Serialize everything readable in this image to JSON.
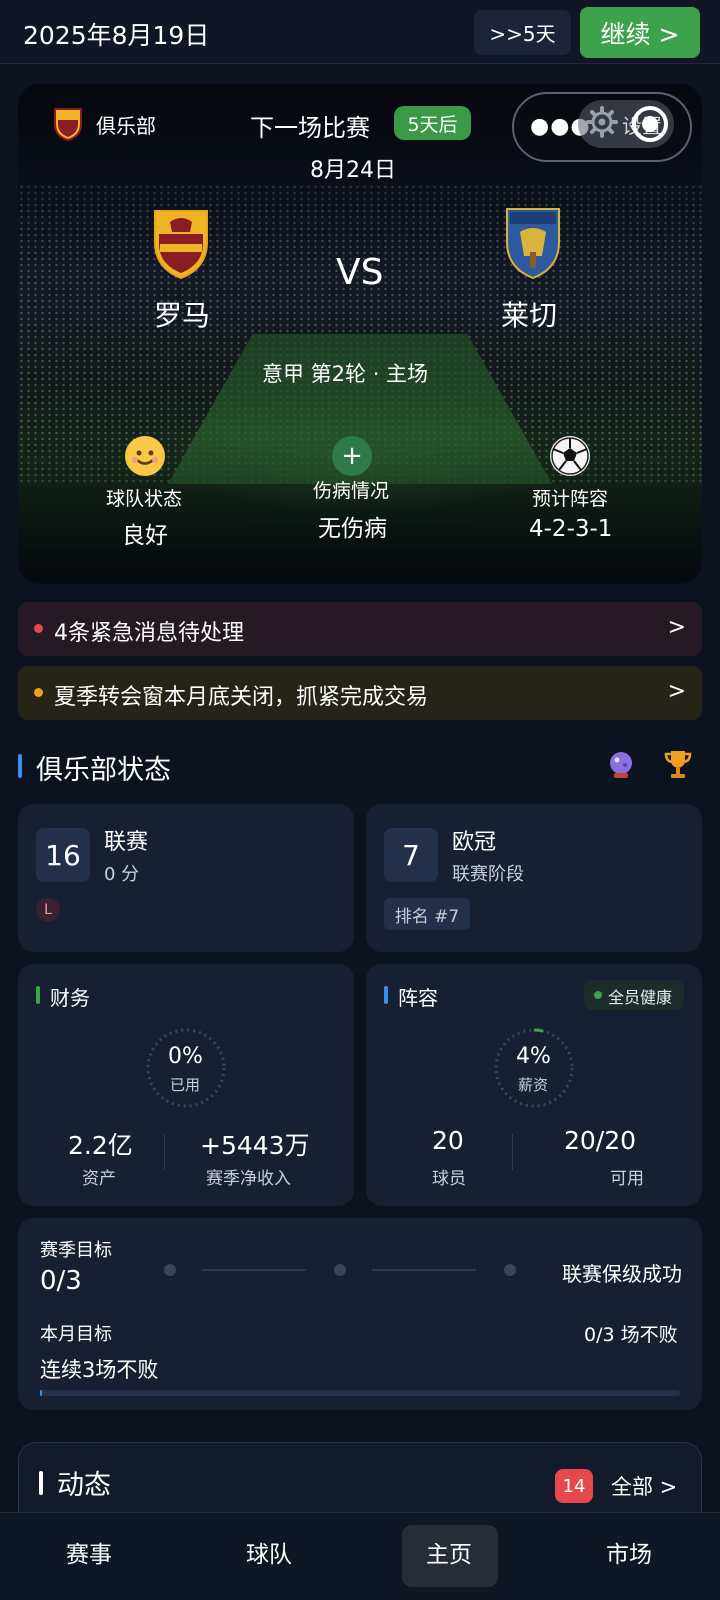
{
  "topbar": {
    "date": "2025年8月19日",
    "skip_label": ">>5天",
    "continue_label": "继续 >"
  },
  "match": {
    "club_label": "俱乐部",
    "next_label": "下一场比赛",
    "days_badge": "5天后",
    "date": "8月24日",
    "settings_label": "设置",
    "home_team": "罗马",
    "away_team": "莱切",
    "vs": "VS",
    "competition": "意甲 第2轮  ·  主场",
    "stats": [
      {
        "label": "球队状态",
        "value": "良好",
        "icon": "smiling-face-icon"
      },
      {
        "label": "伤病情况",
        "value": "无伤病",
        "icon": "medical-cross-icon"
      },
      {
        "label": "预计阵容",
        "value": "4-2-3-1",
        "icon": "soccer-ball-icon"
      }
    ]
  },
  "alerts": [
    {
      "text": "4条紧急消息待处理",
      "arrow": ">",
      "color": "#e5484d"
    },
    {
      "text": "夏季转会窗本月底关闭，抓紧完成交易",
      "arrow": ">",
      "color": "#f0a020"
    }
  ],
  "club_status": {
    "title": "俱乐部状态",
    "league": {
      "rank": "16",
      "name": "联赛",
      "points": "0 分",
      "form": "L"
    },
    "ucl": {
      "rank": "7",
      "name": "欧冠",
      "stage": "联赛阶段",
      "position": "排名 #7"
    },
    "finance": {
      "title": "财务",
      "ring_value": "0%",
      "ring_label": "已用",
      "ring_fraction": 0,
      "assets_value": "2.2亿",
      "assets_label": "资产",
      "income_value": "+5443万",
      "income_label": "赛季净收入"
    },
    "squad": {
      "title": "阵容",
      "badge": "全员健康",
      "ring_value": "4%",
      "ring_label": "薪资",
      "ring_fraction": 0.04,
      "players_value": "20",
      "players_label": "球员",
      "available_value": "20/20",
      "available_label": "可用"
    }
  },
  "goals": {
    "season_label": "赛季目标",
    "season_progress": "0/3",
    "season_goal": "联赛保级成功",
    "month_label": "本月目标",
    "month_goal": "连续3场不败",
    "month_progress": "0/3 场不败",
    "month_fraction": 0
  },
  "feed": {
    "title": "动态",
    "count": "14",
    "all_label": "全部 >"
  },
  "nav": {
    "items": [
      "赛事",
      "球队",
      "主页",
      "市场"
    ],
    "active": "主页"
  },
  "colors": {
    "accent_green": "#3da24b",
    "accent_blue": "#3c8fe8",
    "background": "#0d1220"
  }
}
